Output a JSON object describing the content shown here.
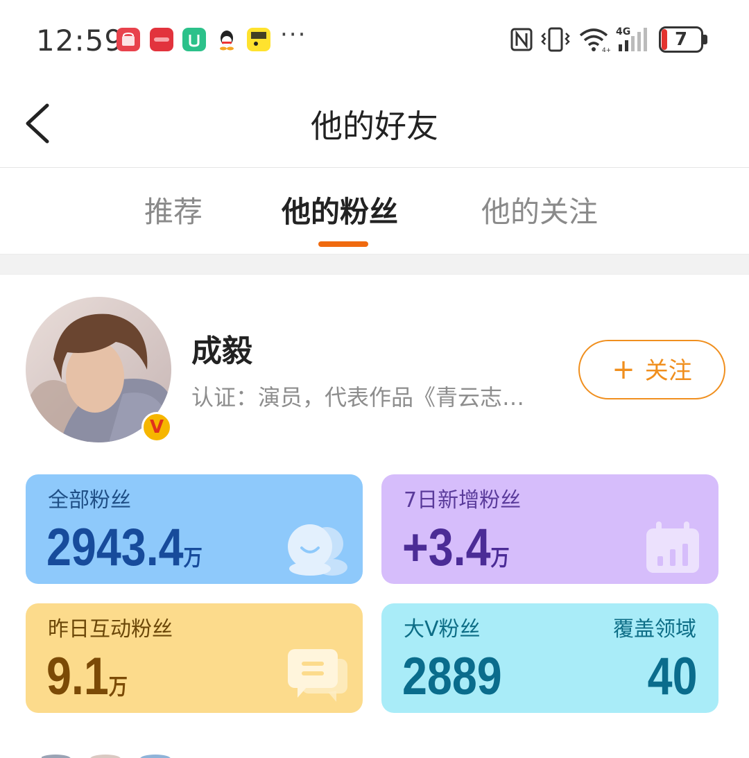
{
  "status_bar": {
    "time": "12:59",
    "battery_level": "7",
    "app_icons": [
      "huawei-appgallery-icon",
      "red-app-icon",
      "mijia-icon",
      "qq-icon",
      "xianyu-icon"
    ],
    "more": "···"
  },
  "header": {
    "title": "他的好友"
  },
  "tabs": [
    {
      "label": "推荐",
      "active": false
    },
    {
      "label": "他的粉丝",
      "active": true
    },
    {
      "label": "他的关注",
      "active": false
    }
  ],
  "profile": {
    "name": "成毅",
    "verification": "认证：演员，代表作品《青云志…",
    "badge": "V",
    "follow_label": "关注",
    "follow_plus": "+"
  },
  "stats": {
    "all_fans": {
      "label": "全部粉丝",
      "value": "2943.4",
      "unit": "万"
    },
    "new_fans_7d": {
      "label": "7日新增粉丝",
      "value": "+3.4",
      "unit": "万"
    },
    "interactive_fans": {
      "label": "昨日互动粉丝",
      "value": "9.1",
      "unit": "万"
    },
    "big_v_fans": {
      "label": "大V粉丝",
      "value": "2889",
      "coverage_label": "覆盖领域",
      "coverage_value": "40"
    }
  },
  "colors": {
    "accent": "#f06a0f",
    "follow": "#f08f1e",
    "card_blue": "#8ec9fb",
    "card_purple": "#d6bdfb",
    "card_yellow": "#fcdb8c",
    "card_cyan": "#a9ecf8"
  }
}
